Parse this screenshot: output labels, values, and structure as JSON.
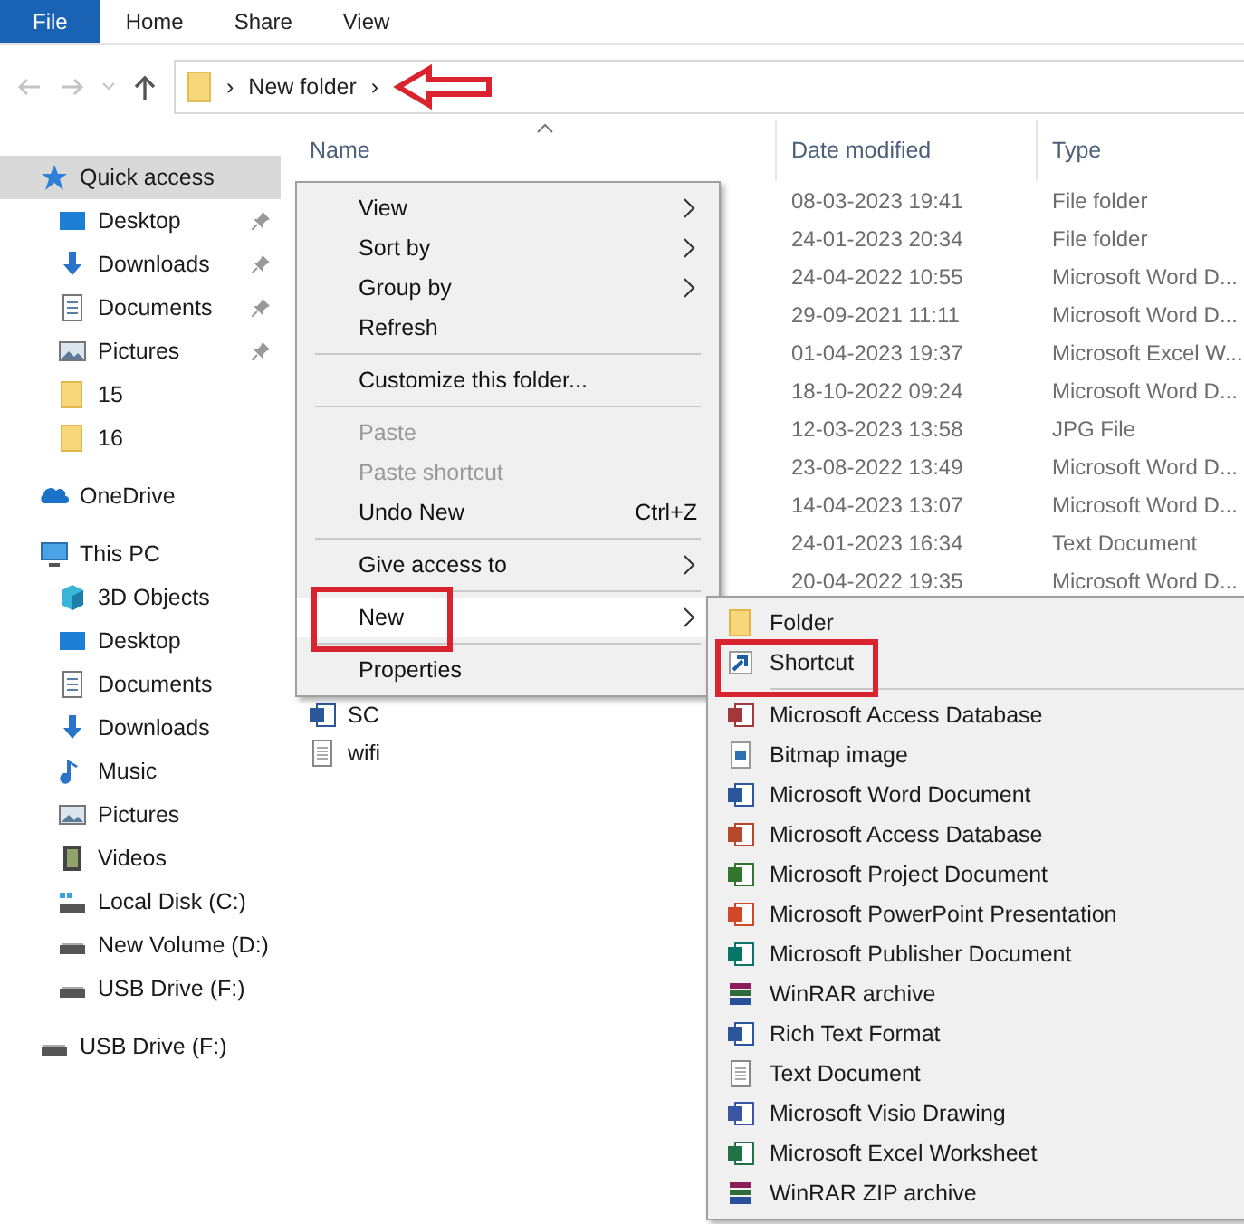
{
  "ribbon": {
    "tabs": [
      {
        "label": "File",
        "selected": true
      },
      {
        "label": "Home",
        "selected": false
      },
      {
        "label": "Share",
        "selected": false
      },
      {
        "label": "View",
        "selected": false
      }
    ]
  },
  "address_bar": {
    "crumbs": [
      "›",
      "New folder",
      "›"
    ],
    "pointer_arrow": true
  },
  "sidebar": {
    "items": [
      {
        "label": "Quick access",
        "kind": "star",
        "selected": true,
        "children": [
          {
            "label": "Desktop",
            "kind": "desktop",
            "pinned": true,
            "selected": false
          },
          {
            "label": "Downloads",
            "kind": "download",
            "pinned": true,
            "selected": false
          },
          {
            "label": "Documents",
            "kind": "document",
            "pinned": true,
            "selected": false
          },
          {
            "label": "Pictures",
            "kind": "pictures",
            "pinned": true,
            "selected": false
          },
          {
            "label": "15",
            "kind": "folder",
            "pinned": false,
            "selected": false
          },
          {
            "label": "16",
            "kind": "folder",
            "pinned": false,
            "selected": false
          }
        ]
      },
      {
        "label": "OneDrive",
        "kind": "cloud",
        "selected": false
      },
      {
        "label": "This PC",
        "kind": "pc",
        "selected": false,
        "children": [
          {
            "label": "3D Objects",
            "kind": "cube",
            "selected": false
          },
          {
            "label": "Desktop",
            "kind": "desktop",
            "selected": false
          },
          {
            "label": "Documents",
            "kind": "document",
            "selected": false
          },
          {
            "label": "Downloads",
            "kind": "download",
            "selected": false
          },
          {
            "label": "Music",
            "kind": "music",
            "selected": false
          },
          {
            "label": "Pictures",
            "kind": "pictures",
            "selected": false
          },
          {
            "label": "Videos",
            "kind": "video",
            "selected": false
          },
          {
            "label": "Local Disk (C:)",
            "kind": "disk",
            "selected": false
          },
          {
            "label": "New Volume (D:)",
            "kind": "drive",
            "selected": false
          },
          {
            "label": "USB Drive (F:)",
            "kind": "drive",
            "selected": false
          }
        ]
      },
      {
        "label": "USB Drive (F:)",
        "kind": "drive",
        "selected": false
      }
    ]
  },
  "file_list": {
    "columns": [
      "Name",
      "Date modified",
      "Type"
    ],
    "rows": [
      {
        "date": "08-03-2023 19:41",
        "type": "File folder"
      },
      {
        "date": "24-01-2023 20:34",
        "type": "File folder"
      },
      {
        "date": "24-04-2022 10:55",
        "type": "Microsoft Word D..."
      },
      {
        "date": "29-09-2021 11:11",
        "type": "Microsoft Word D..."
      },
      {
        "date": "01-04-2023 19:37",
        "type": "Microsoft Excel W..."
      },
      {
        "date": "18-10-2022 09:24",
        "type": "Microsoft Word D..."
      },
      {
        "date": "12-03-2023 13:58",
        "type": "JPG File"
      },
      {
        "date": "23-08-2022 13:49",
        "type": "Microsoft Word D..."
      },
      {
        "date": "14-04-2023 13:07",
        "type": "Microsoft Word D..."
      },
      {
        "date": "24-01-2023 16:34",
        "type": "Text Document"
      },
      {
        "date": "20-04-2022 19:35",
        "type": "Microsoft Word D..."
      }
    ],
    "files": [
      {
        "name": "SC",
        "kind": "word"
      },
      {
        "name": "wifi",
        "kind": "text"
      }
    ]
  },
  "context_menu": {
    "items": [
      {
        "kind": "item",
        "label": "View",
        "submenu": true,
        "disabled": false,
        "selected": false,
        "highlighted": false
      },
      {
        "kind": "item",
        "label": "Sort by",
        "submenu": true,
        "disabled": false,
        "selected": false,
        "highlighted": false
      },
      {
        "kind": "item",
        "label": "Group by",
        "submenu": true,
        "disabled": false,
        "selected": false,
        "highlighted": false
      },
      {
        "kind": "item",
        "label": "Refresh",
        "submenu": false,
        "disabled": false,
        "selected": false,
        "highlighted": false
      },
      {
        "kind": "separator"
      },
      {
        "kind": "item",
        "label": "Customize this folder...",
        "submenu": false,
        "disabled": false,
        "selected": false,
        "highlighted": false
      },
      {
        "kind": "separator"
      },
      {
        "kind": "item",
        "label": "Paste",
        "submenu": false,
        "disabled": true,
        "selected": false,
        "highlighted": false
      },
      {
        "kind": "item",
        "label": "Paste shortcut",
        "submenu": false,
        "disabled": true,
        "selected": false,
        "highlighted": false
      },
      {
        "kind": "item",
        "label": "Undo New",
        "shortcut": "Ctrl+Z",
        "submenu": false,
        "disabled": false,
        "selected": false,
        "highlighted": false
      },
      {
        "kind": "separator"
      },
      {
        "kind": "item",
        "label": "Give access to",
        "submenu": true,
        "disabled": false,
        "selected": false,
        "highlighted": false
      },
      {
        "kind": "separator"
      },
      {
        "kind": "item",
        "label": "New",
        "submenu": true,
        "disabled": false,
        "selected": true,
        "highlighted": true
      },
      {
        "kind": "separator"
      },
      {
        "kind": "item",
        "label": "Properties",
        "submenu": false,
        "disabled": false,
        "selected": false,
        "highlighted": false
      }
    ]
  },
  "new_submenu": {
    "items": [
      {
        "kind": "folder",
        "label": "Folder",
        "highlighted": false
      },
      {
        "kind": "shortcut",
        "label": "Shortcut",
        "highlighted": true
      },
      {
        "kind": "separator"
      },
      {
        "kind": "office",
        "label": "Microsoft Access Database",
        "color": "#a4373a",
        "highlighted": false
      },
      {
        "kind": "bitmap",
        "label": "Bitmap image",
        "highlighted": false
      },
      {
        "kind": "office",
        "label": "Microsoft Word Document",
        "color": "#2b579a",
        "highlighted": false
      },
      {
        "kind": "office",
        "label": "Microsoft Access Database",
        "color": "#b7472a",
        "highlighted": false
      },
      {
        "kind": "office",
        "label": "Microsoft Project Document",
        "color": "#31752f",
        "highlighted": false
      },
      {
        "kind": "office",
        "label": "Microsoft PowerPoint Presentation",
        "color": "#d24726",
        "highlighted": false
      },
      {
        "kind": "office",
        "label": "Microsoft Publisher Document",
        "color": "#077568",
        "highlighted": false
      },
      {
        "kind": "archive",
        "label": "WinRAR archive",
        "highlighted": false
      },
      {
        "kind": "office",
        "label": "Rich Text Format",
        "color": "#2b579a",
        "highlighted": false
      },
      {
        "kind": "text",
        "label": "Text Document",
        "highlighted": false
      },
      {
        "kind": "office",
        "label": "Microsoft Visio Drawing",
        "color": "#3955a3",
        "highlighted": false
      },
      {
        "kind": "office",
        "label": "Microsoft Excel Worksheet",
        "color": "#217346",
        "highlighted": false
      },
      {
        "kind": "archive",
        "label": "WinRAR ZIP archive",
        "highlighted": false
      }
    ]
  }
}
